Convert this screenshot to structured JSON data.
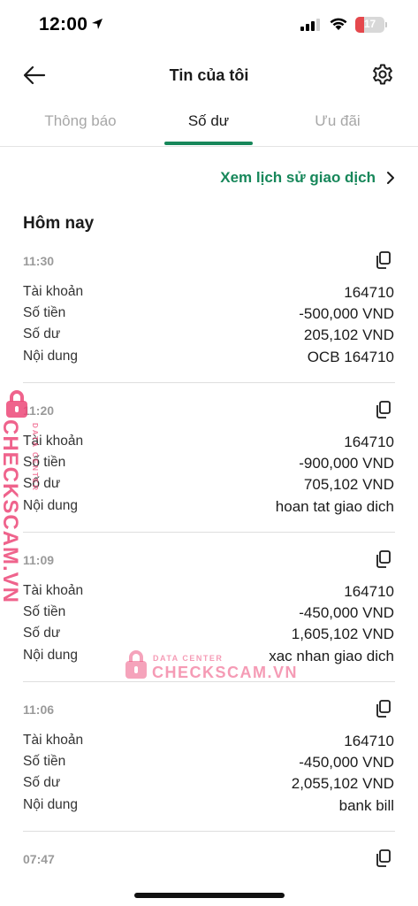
{
  "status_bar": {
    "time": "12:00",
    "battery": "17"
  },
  "header": {
    "title": "Tin của tôi"
  },
  "tabs": [
    {
      "label": "Thông báo",
      "active": false
    },
    {
      "label": "Số dư",
      "active": true
    },
    {
      "label": "Ưu đãi",
      "active": false
    }
  ],
  "history_link": "Xem lịch sử giao dịch",
  "section_title": "Hôm nay",
  "labels": {
    "account": "Tài khoản",
    "amount": "Số tiền",
    "balance": "Số dư",
    "content": "Nội dung"
  },
  "transactions": [
    {
      "time": "11:30",
      "account": "164710",
      "amount": "-500,000 VND",
      "balance": "205,102 VND",
      "content": "OCB 164710"
    },
    {
      "time": "11:20",
      "account": "164710",
      "amount": "-900,000 VND",
      "balance": "705,102 VND",
      "content": "hoan tat giao dich"
    },
    {
      "time": "11:09",
      "account": "164710",
      "amount": "-450,000 VND",
      "balance": "1,605,102 VND",
      "content": "xac nhan giao dich"
    },
    {
      "time": "11:06",
      "account": "164710",
      "amount": "-450,000 VND",
      "balance": "2,055,102 VND",
      "content": "bank bill"
    },
    {
      "time": "07:47"
    }
  ],
  "watermark": {
    "brand": "CHECKSCAM.VN",
    "sub": "DATA CENTER"
  },
  "colors": {
    "accent": "#17875a",
    "watermark": "#ec4878"
  }
}
